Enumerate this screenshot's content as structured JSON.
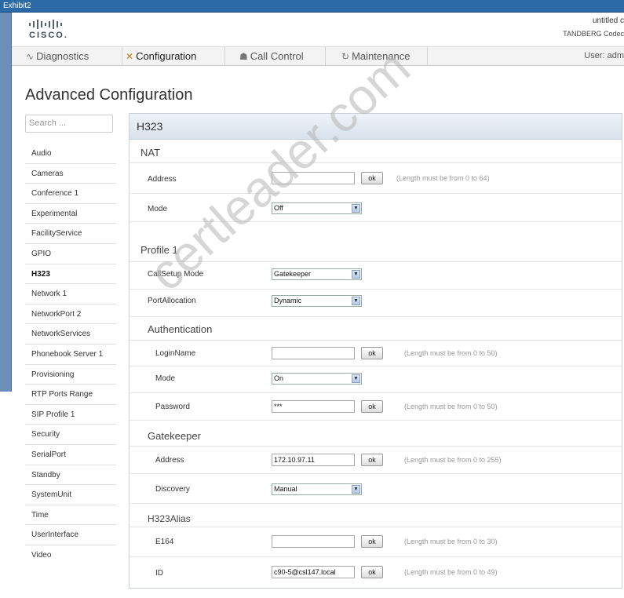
{
  "window": {
    "title": "Exhibit2"
  },
  "header": {
    "logo_text": "CISCO.",
    "system_name": "untitled c",
    "product": "TANDBERG Codec"
  },
  "nav": {
    "items": [
      {
        "label": "Diagnostics",
        "icon": "pulse-icon"
      },
      {
        "label": "Configuration",
        "icon": "wrench-screwdriver-icon"
      },
      {
        "label": "Call Control",
        "icon": "people-icon"
      },
      {
        "label": "Maintenance",
        "icon": "refresh-icon"
      }
    ],
    "user": "User: adm"
  },
  "page": {
    "title": "Advanced Configuration"
  },
  "search": {
    "placeholder": "Search ..."
  },
  "sidebar": {
    "items": [
      "Audio",
      "Cameras",
      "Conference 1",
      "Experimental",
      "FacilityService",
      "GPIO",
      "H323",
      "Network 1",
      "NetworkPort 2",
      "NetworkServices",
      "Phonebook Server 1",
      "Provisioning",
      "RTP Ports Range",
      "SIP Profile 1",
      "Security",
      "SerialPort",
      "Standby",
      "SystemUnit",
      "Time",
      "UserInterface",
      "Video"
    ],
    "active": "H323"
  },
  "panel": {
    "title": "H323",
    "nat": {
      "title": "NAT",
      "address_label": "Address",
      "address_value": "",
      "address_hint": "(Length must be from 0 to 64)",
      "mode_label": "Mode",
      "mode_value": "Off"
    },
    "profile": {
      "title": "Profile 1",
      "callsetup_label": "CallSetup Mode",
      "callsetup_value": "Gatekeeper",
      "portalloc_label": "PortAllocation",
      "portalloc_value": "Dynamic"
    },
    "authentication": {
      "title": "Authentication",
      "loginname_label": "LoginName",
      "loginname_value": "",
      "loginname_hint": "(Length must be from 0 to 50)",
      "mode_label": "Mode",
      "mode_value": "On",
      "password_label": "Password",
      "password_value": "***",
      "password_hint": "(Length must be from 0 to 50)"
    },
    "gatekeeper": {
      "title": "Gatekeeper",
      "address_label": "Address",
      "address_value": "172.10.97.11",
      "address_hint": "(Length must be from 0 to 255)",
      "discovery_label": "Discovery",
      "discovery_value": "Manual"
    },
    "alias": {
      "title": "H323Alias",
      "e164_label": "E164",
      "e164_value": "",
      "e164_hint": "(Length must be from 0 to 30)",
      "id_label": "ID",
      "id_value": "c90-5@csl147.local",
      "id_hint": "(Length must be from 0 to 49)"
    },
    "ok_label": "ok"
  },
  "watermark": "certleader.com"
}
